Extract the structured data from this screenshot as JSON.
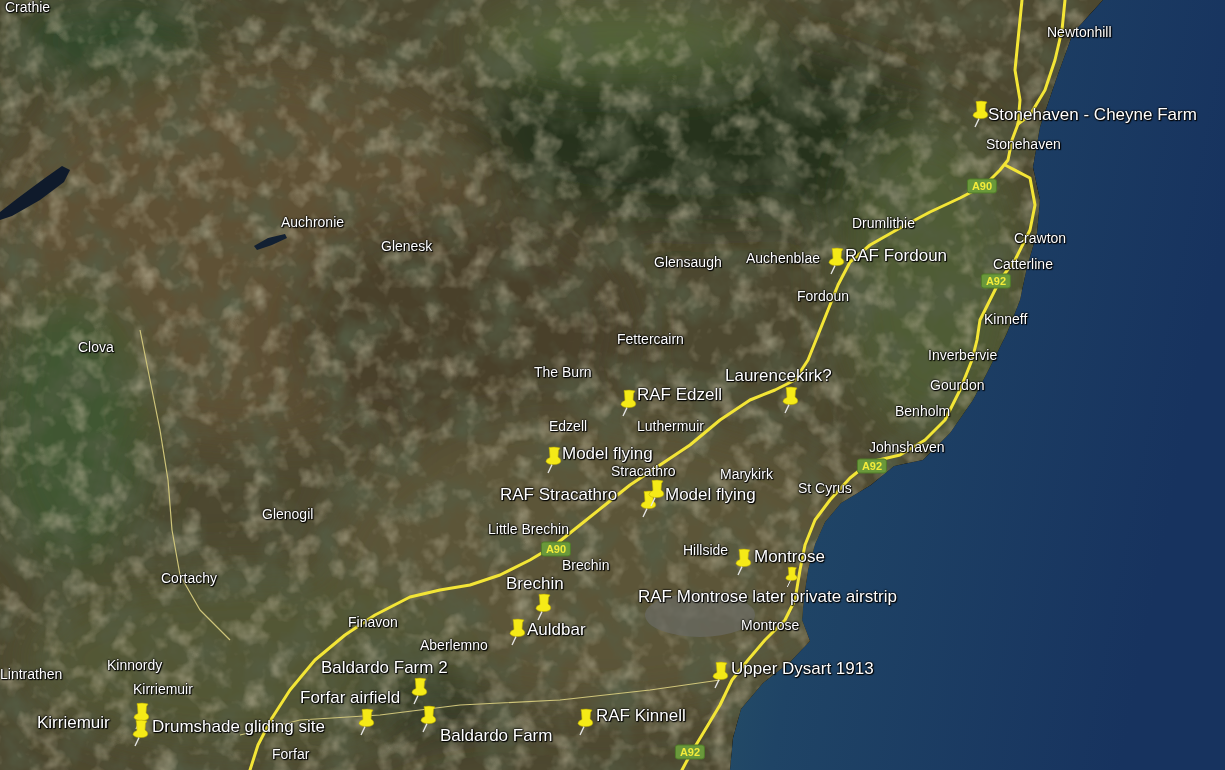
{
  "map": {
    "places": [
      {
        "name": "Crathie"
      },
      {
        "name": "Newtonhill"
      },
      {
        "name": "Stonehaven"
      },
      {
        "name": "Auchronie"
      },
      {
        "name": "Drumlithie"
      },
      {
        "name": "Glenesk"
      },
      {
        "name": "Crawton"
      },
      {
        "name": "Glensaugh"
      },
      {
        "name": "Auchenblae"
      },
      {
        "name": "Catterline"
      },
      {
        "name": "Fordoun"
      },
      {
        "name": "Kinneff"
      },
      {
        "name": "Clova"
      },
      {
        "name": "Fettercairn"
      },
      {
        "name": "Inverbervie"
      },
      {
        "name": "The Burn"
      },
      {
        "name": "Gourdon"
      },
      {
        "name": "Benholm"
      },
      {
        "name": "Edzell"
      },
      {
        "name": "Luthermuir"
      },
      {
        "name": "Johnshaven"
      },
      {
        "name": "Stracathro"
      },
      {
        "name": "Marykirk"
      },
      {
        "name": "St Cyrus"
      },
      {
        "name": "Glenogil"
      },
      {
        "name": "Little Brechin"
      },
      {
        "name": "Hillside"
      },
      {
        "name": "Cortachy"
      },
      {
        "name": "Brechin"
      },
      {
        "name": "Finavon"
      },
      {
        "name": "Montrose"
      },
      {
        "name": "Aberlemno"
      },
      {
        "name": "Lintrathen"
      },
      {
        "name": "Kinnordy"
      },
      {
        "name": "Kirriemuir"
      },
      {
        "name": "Forfar"
      }
    ],
    "road_numbers": [
      {
        "label": "A90"
      },
      {
        "label": "A92"
      },
      {
        "label": "A92"
      },
      {
        "label": "A90"
      },
      {
        "label": "A92"
      }
    ],
    "placemarks": [
      {
        "label": "Stonehaven - Cheyne Farm"
      },
      {
        "label": "RAF Fordoun"
      },
      {
        "label": "Laurencekirk?"
      },
      {
        "label": "RAF Edzell"
      },
      {
        "label": "Model flying"
      },
      {
        "label": "RAF Stracathro"
      },
      {
        "label": "Model flying"
      },
      {
        "label": "Montrose"
      },
      {
        "label": "Brechin"
      },
      {
        "label": "RAF Montrose later private airstrip"
      },
      {
        "label": "Auldbar"
      },
      {
        "label": "Baldardo Farm 2"
      },
      {
        "label": "Upper Dysart 1913"
      },
      {
        "label": "Forfar airfield"
      },
      {
        "label": "Kirriemuir"
      },
      {
        "label": "Drumshade gliding site"
      },
      {
        "label": "Baldardo Farm"
      },
      {
        "label": "RAF Kinnell"
      }
    ]
  }
}
